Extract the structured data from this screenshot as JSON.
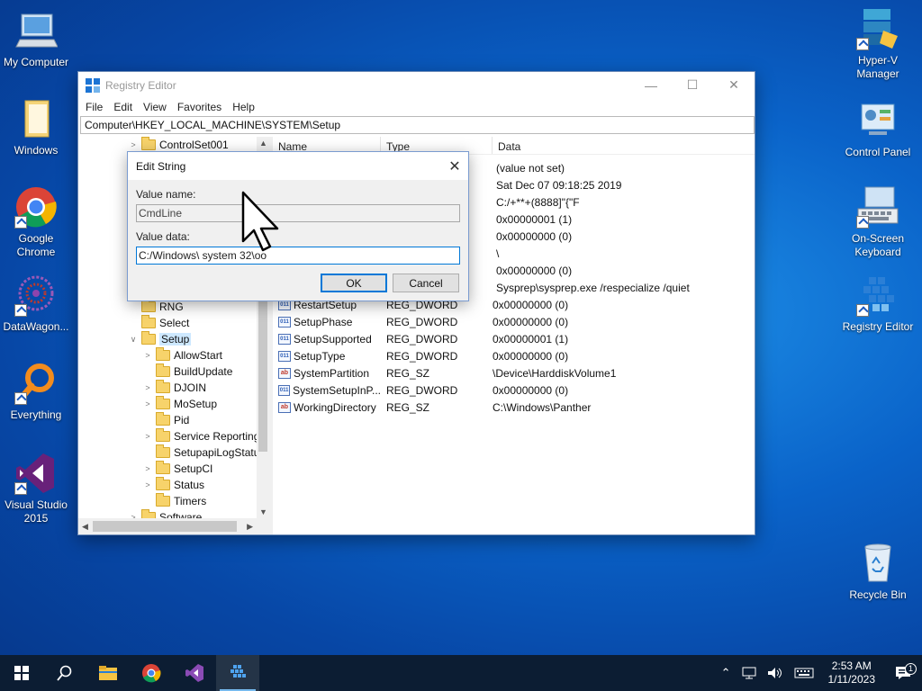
{
  "desktop": {
    "left_icons": [
      {
        "label": "My Computer",
        "icon": "computer-icon"
      },
      {
        "label": "Windows",
        "icon": "folder-icon"
      },
      {
        "label": "Google Chrome",
        "icon": "chrome-icon"
      },
      {
        "label": "DataWagon...",
        "icon": "datawagon-icon"
      },
      {
        "label": "Everything",
        "icon": "search-icon"
      },
      {
        "label": "Visual Studio 2015",
        "icon": "visual-studio-icon"
      }
    ],
    "right_icons": [
      {
        "label": "Hyper-V Manager",
        "icon": "hyperv-icon"
      },
      {
        "label": "Control Panel",
        "icon": "control-panel-icon"
      },
      {
        "label": "On-Screen Keyboard",
        "icon": "keyboard-icon"
      },
      {
        "label": "Registry Editor",
        "icon": "registry-icon"
      },
      {
        "label": "Recycle Bin",
        "icon": "recycle-bin-icon"
      }
    ]
  },
  "window": {
    "title": "Registry Editor",
    "menu": [
      "File",
      "Edit",
      "View",
      "Favorites",
      "Help"
    ],
    "address": "Computer\\HKEY_LOCAL_MACHINE\\SYSTEM\\Setup",
    "tree": [
      {
        "label": "ControlSet001",
        "indent": 0,
        "arrow": ">"
      },
      {
        "label": "RNG",
        "indent": 0,
        "arrow": ""
      },
      {
        "label": "Select",
        "indent": 0,
        "arrow": ""
      },
      {
        "label": "Setup",
        "indent": 0,
        "arrow": "v",
        "selected": true
      },
      {
        "label": "AllowStart",
        "indent": 1,
        "arrow": ">"
      },
      {
        "label": "BuildUpdate",
        "indent": 1,
        "arrow": ""
      },
      {
        "label": "DJOIN",
        "indent": 1,
        "arrow": ">"
      },
      {
        "label": "MoSetup",
        "indent": 1,
        "arrow": ">"
      },
      {
        "label": "Pid",
        "indent": 1,
        "arrow": ""
      },
      {
        "label": "Service Reporting",
        "indent": 1,
        "arrow": ">"
      },
      {
        "label": "SetupapiLogStatu",
        "indent": 1,
        "arrow": ""
      },
      {
        "label": "SetupCI",
        "indent": 1,
        "arrow": ">"
      },
      {
        "label": "Status",
        "indent": 1,
        "arrow": ">"
      },
      {
        "label": "Timers",
        "indent": 1,
        "arrow": ""
      },
      {
        "label": "Software",
        "indent": 0,
        "arrow": ">"
      }
    ],
    "columns": {
      "name": "Name",
      "type": "Type",
      "data": "Data"
    },
    "hidden_rows_data": [
      "(value not set)",
      "Sat Dec 07 09:18:25 2019",
      "C:/+**+(8888]\"{\"F",
      "0x00000001 (1)",
      "0x00000000 (0)",
      "\\",
      "0x00000000 (0)",
      "Sysprep\\sysprep.exe /respecialize /quiet"
    ],
    "rows": [
      {
        "name": "RestartSetup",
        "type": "REG_DWORD",
        "data": "0x00000000 (0)",
        "kind": "dw"
      },
      {
        "name": "SetupPhase",
        "type": "REG_DWORD",
        "data": "0x00000000 (0)",
        "kind": "dw"
      },
      {
        "name": "SetupSupported",
        "type": "REG_DWORD",
        "data": "0x00000001 (1)",
        "kind": "dw"
      },
      {
        "name": "SetupType",
        "type": "REG_DWORD",
        "data": "0x00000000 (0)",
        "kind": "dw"
      },
      {
        "name": "SystemPartition",
        "type": "REG_SZ",
        "data": "\\Device\\HarddiskVolume1",
        "kind": "sz"
      },
      {
        "name": "SystemSetupInP...",
        "type": "REG_DWORD",
        "data": "0x00000000 (0)",
        "kind": "dw"
      },
      {
        "name": "WorkingDirectory",
        "type": "REG_SZ",
        "data": "C:\\Windows\\Panther",
        "kind": "sz"
      }
    ]
  },
  "dialog": {
    "title": "Edit String",
    "value_name_label": "Value name:",
    "value_name": "CmdLine",
    "value_data_label": "Value data:",
    "value_data": "C:/Windows\\ system 32\\oo",
    "ok": "OK",
    "cancel": "Cancel"
  },
  "taskbar": {
    "time": "2:53 AM",
    "date": "1/11/2023",
    "notification_count": "1"
  }
}
